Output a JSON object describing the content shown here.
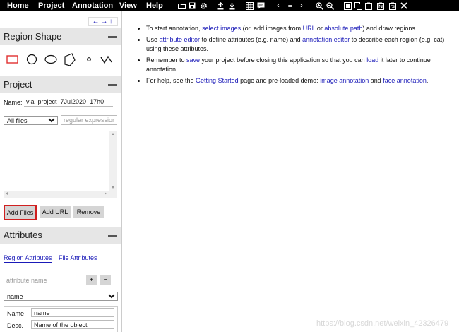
{
  "menu": {
    "home": "Home",
    "project": "Project",
    "annotation": "Annotation",
    "view": "View",
    "help": "Help"
  },
  "toolbar": {
    "prev_arrow": "‹",
    "list": "≡",
    "next_arrow": "›"
  },
  "side_nav": {
    "left_arrow": "←",
    "right_arrow": "→",
    "up_arrow": "↑"
  },
  "region_shape": {
    "title": "Region Shape",
    "shapes": [
      "rectangle",
      "circle",
      "ellipse",
      "polygon",
      "point",
      "polyline"
    ]
  },
  "project": {
    "title": "Project",
    "name_label": "Name:",
    "name_value": "via_project_7Jul2020_17h0",
    "filter_select": "All files",
    "regex_placeholder": "regular expression",
    "add_files": "Add Files",
    "add_url": "Add URL",
    "remove": "Remove"
  },
  "attributes": {
    "title": "Attributes",
    "tab_region": "Region Attributes",
    "tab_file": "File Attributes",
    "attr_name_placeholder": "attribute name",
    "add": "+",
    "remove": "−",
    "selected": "name",
    "rows": [
      {
        "label": "Name",
        "value": "name"
      },
      {
        "label": "Desc.",
        "value": "Name of the object"
      }
    ]
  },
  "help": {
    "i1": {
      "t1": "To start annotation, ",
      "l1": "select images",
      "t2": " (or, add images from ",
      "l2": "URL",
      "t3": " or ",
      "l3": "absolute path",
      "t4": ") and draw regions"
    },
    "i2": {
      "t1": "Use ",
      "l1": "attribute editor",
      "t2": " to define attributes (e.g. name) and ",
      "l2": "annotation editor",
      "t3": " to describe each region (e.g. cat) using these attributes."
    },
    "i3": {
      "t1": "Remember to ",
      "l1": "save",
      "t2": " your project before closing this application so that you can ",
      "l2": "load",
      "t3": " it later to continue annotation."
    },
    "i4": {
      "t1": "For help, see the ",
      "l1": "Getting Started",
      "t2": " page and pre-loaded demo: ",
      "l2": "image annotation",
      "t3": " and ",
      "l3": "face annotation",
      "t4": "."
    }
  },
  "watermark": "https://blog.csdn.net/weixin_42326479",
  "colors": {
    "topbar": "#000000",
    "panel_header": "#e6e6e6",
    "link": "#1a1ab8",
    "highlight": "#d02020",
    "rect_shape": "#e03030"
  }
}
